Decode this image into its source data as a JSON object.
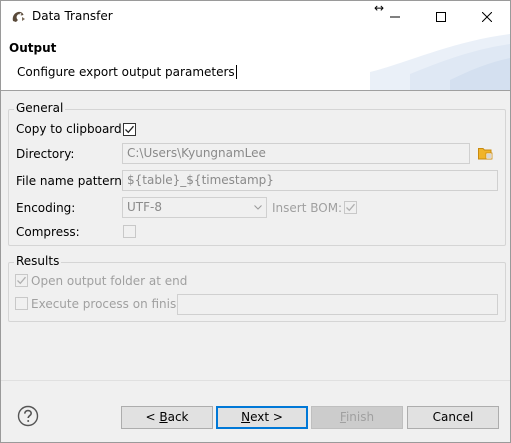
{
  "window": {
    "title": "Data Transfer",
    "resize_glyph": "↔"
  },
  "header": {
    "title": "Output",
    "description": "Configure export output parameters"
  },
  "general": {
    "legend": "General",
    "copy_to_clipboard": {
      "label": "Copy to clipboard:",
      "checked": true
    },
    "directory": {
      "label": "Directory:",
      "value": "C:\\Users\\KyungnamLee"
    },
    "file_name_pattern": {
      "label": "File name pattern:",
      "value": "${table}_${timestamp}"
    },
    "encoding": {
      "label": "Encoding:",
      "value": "UTF-8"
    },
    "insert_bom": {
      "label": "Insert BOM:",
      "checked": true
    },
    "compress": {
      "label": "Compress:",
      "checked": false
    }
  },
  "results": {
    "legend": "Results",
    "open_output_folder": {
      "label": "Open output folder at end",
      "checked": true
    },
    "execute_process": {
      "label": "Execute process on finish",
      "checked": false,
      "command": ""
    }
  },
  "buttons": {
    "back_mnemonic": "B",
    "back_rest": "ack",
    "back_prefix": "< ",
    "next_mnemonic": "N",
    "next_rest": "ext >",
    "finish_mnemonic": "F",
    "finish_rest": "inish",
    "cancel": "Cancel"
  },
  "colors": {
    "accent": "#0078d7",
    "folder_icon": "#e8a317"
  }
}
